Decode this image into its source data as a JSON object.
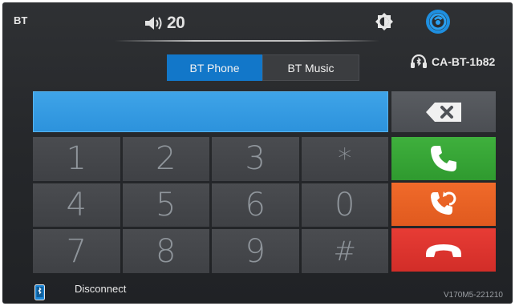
{
  "header": {
    "source_label": "BT",
    "volume_value": "20",
    "brightness_icon": "brightness-icon",
    "settings_icon": "settings-icon"
  },
  "tabs": [
    {
      "label": "BT Phone",
      "active": true
    },
    {
      "label": "BT Music",
      "active": false
    }
  ],
  "device": {
    "icon": "headset-bluetooth-icon",
    "name": "CA-BT-1b82"
  },
  "dial_display": {
    "value": ""
  },
  "keypad": {
    "keys": [
      "1",
      "2",
      "3",
      "*",
      "4",
      "5",
      "6",
      "0",
      "7",
      "8",
      "9",
      "#"
    ]
  },
  "side_buttons": {
    "backspace_icon": "backspace-icon",
    "call_icon": "phone-call-icon",
    "swap_icon": "phone-transfer-icon",
    "hangup_icon": "phone-hangup-icon"
  },
  "footer": {
    "phone_icon": "phone-bluetooth-icon",
    "disconnect_label": "Disconnect",
    "version": "V170M5-221210"
  },
  "colors": {
    "accent": "#1277c9",
    "display": "#2c92dc",
    "call": "#35a535",
    "swap": "#e8622a",
    "hangup": "#de332e"
  }
}
